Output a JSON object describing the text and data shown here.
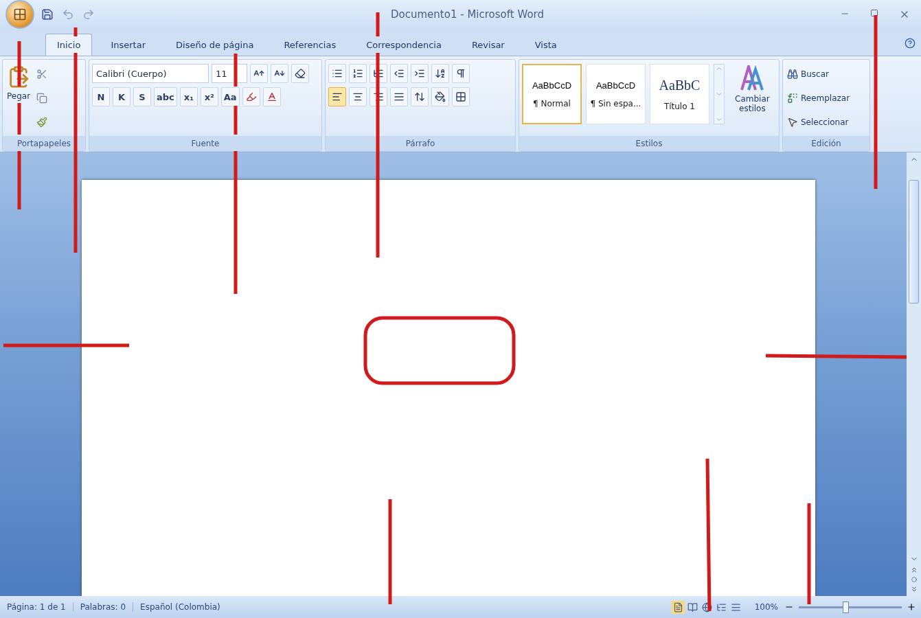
{
  "window": {
    "title": "Documento1 - Microsoft Word"
  },
  "tabs": [
    {
      "label": "Inicio",
      "selected": true
    },
    {
      "label": "Insertar",
      "selected": false
    },
    {
      "label": "Diseño de página",
      "selected": false
    },
    {
      "label": "Referencias",
      "selected": false
    },
    {
      "label": "Correspondencia",
      "selected": false
    },
    {
      "label": "Revisar",
      "selected": false
    },
    {
      "label": "Vista",
      "selected": false
    }
  ],
  "ribbon": {
    "clipboard": {
      "paste_label": "Pegar",
      "group_label": "Portapapeles"
    },
    "font": {
      "font_name": "Calibri (Cuerpo)",
      "font_size": "11",
      "format_buttons": [
        "N",
        "K",
        "S",
        "abc",
        "x₁",
        "x²",
        "Aa"
      ],
      "group_label": "Fuente"
    },
    "paragraph": {
      "group_label": "Párrafo"
    },
    "styles": {
      "items": [
        {
          "preview": "AaBbCcD",
          "name": "¶ Normal",
          "kind": "body",
          "selected": true
        },
        {
          "preview": "AaBbCcD",
          "name": "¶ Sin espa...",
          "kind": "body",
          "selected": false
        },
        {
          "preview": "AaBbC",
          "name": "Título 1",
          "kind": "heading",
          "selected": false
        }
      ],
      "change_label": "Cambiar estilos",
      "group_label": "Estilos"
    },
    "editing": {
      "items": [
        "Buscar",
        "Reemplazar",
        "Seleccionar"
      ],
      "group_label": "Edición"
    }
  },
  "status_bar": {
    "page": "Página: 1 de 1",
    "words": "Palabras: 0",
    "language": "Español (Colombia)",
    "zoom": "100%",
    "zoom_level": {
      "level": 0.45
    }
  }
}
